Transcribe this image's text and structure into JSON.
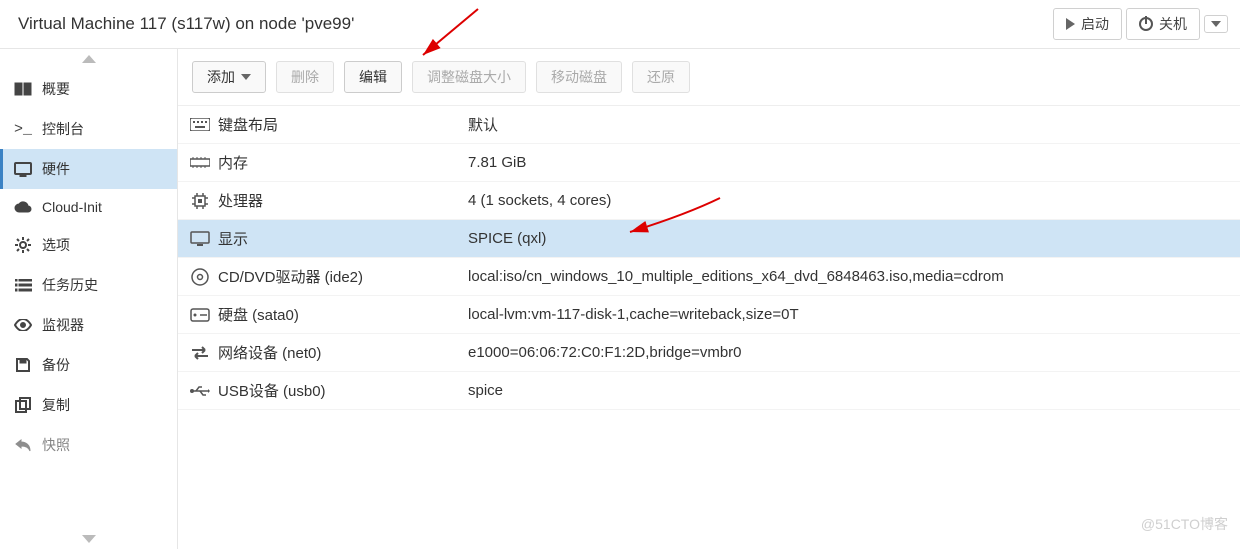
{
  "title": "Virtual Machine 117 (s117w) on node 'pve99'",
  "header": {
    "start": "启动",
    "shutdown": "关机"
  },
  "sidebar": {
    "items": [
      {
        "label": "概要",
        "icon": "book"
      },
      {
        "label": "控制台",
        "icon": "terminal"
      },
      {
        "label": "硬件",
        "icon": "monitor"
      },
      {
        "label": "Cloud-Init",
        "icon": "cloud"
      },
      {
        "label": "选项",
        "icon": "gear"
      },
      {
        "label": "任务历史",
        "icon": "list"
      },
      {
        "label": "监视器",
        "icon": "eye"
      },
      {
        "label": "备份",
        "icon": "save"
      },
      {
        "label": "复制",
        "icon": "clone"
      },
      {
        "label": "快照",
        "icon": "undo"
      }
    ],
    "active": 2
  },
  "toolbar": {
    "add": "添加",
    "remove": "删除",
    "edit": "编辑",
    "resize": "调整磁盘大小",
    "move": "移动磁盘",
    "revert": "还原"
  },
  "hardware": {
    "rows": [
      {
        "icon": "keyboard",
        "key": "键盘布局",
        "value": "默认"
      },
      {
        "icon": "memory",
        "key": "内存",
        "value": "7.81 GiB"
      },
      {
        "icon": "cpu",
        "key": "处理器",
        "value": "4 (1 sockets, 4 cores)"
      },
      {
        "icon": "display",
        "key": "显示",
        "value": "SPICE (qxl)"
      },
      {
        "icon": "disc",
        "key": "CD/DVD驱动器 (ide2)",
        "value": "local:iso/cn_windows_10_multiple_editions_x64_dvd_6848463.iso,media=cdrom"
      },
      {
        "icon": "hdd",
        "key": "硬盘 (sata0)",
        "value": "local-lvm:vm-117-disk-1,cache=writeback,size=0T"
      },
      {
        "icon": "net",
        "key": "网络设备 (net0)",
        "value": "e1000=06:06:72:C0:F1:2D,bridge=vmbr0"
      },
      {
        "icon": "usb",
        "key": "USB设备 (usb0)",
        "value": "spice"
      }
    ],
    "selected": 3
  },
  "watermark": "@51CTO博客"
}
